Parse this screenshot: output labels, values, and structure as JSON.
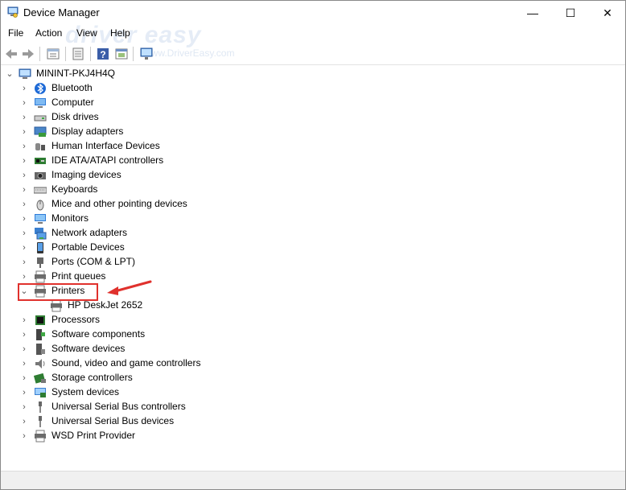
{
  "window": {
    "title": "Device Manager",
    "minimize": "—",
    "maximize": "☐",
    "close": "✕"
  },
  "menu": [
    "File",
    "Action",
    "View",
    "Help"
  ],
  "watermark": {
    "main": "driver easy",
    "sub": "www.DriverEasy.com"
  },
  "toolbar": [
    "back-icon",
    "forward-icon",
    "properties-icon",
    "update-icon",
    "help-icon",
    "device-view-icon",
    "scan-hardware-icon"
  ],
  "tree": {
    "root": "MININT-PKJ4H4Q",
    "categories": [
      {
        "label": "Bluetooth",
        "icon": "bluetooth-icon",
        "expanded": false
      },
      {
        "label": "Computer",
        "icon": "computer-icon",
        "expanded": false
      },
      {
        "label": "Disk drives",
        "icon": "disk-drive-icon",
        "expanded": false
      },
      {
        "label": "Display adapters",
        "icon": "display-adapter-icon",
        "expanded": false
      },
      {
        "label": "Human Interface Devices",
        "icon": "hid-icon",
        "expanded": false
      },
      {
        "label": "IDE ATA/ATAPI controllers",
        "icon": "ide-controller-icon",
        "expanded": false
      },
      {
        "label": "Imaging devices",
        "icon": "camera-icon",
        "expanded": false
      },
      {
        "label": "Keyboards",
        "icon": "keyboard-icon",
        "expanded": false
      },
      {
        "label": "Mice and other pointing devices",
        "icon": "mouse-icon",
        "expanded": false
      },
      {
        "label": "Monitors",
        "icon": "monitor-icon",
        "expanded": false
      },
      {
        "label": "Network adapters",
        "icon": "network-adapter-icon",
        "expanded": false
      },
      {
        "label": "Portable Devices",
        "icon": "portable-device-icon",
        "expanded": false
      },
      {
        "label": "Ports (COM & LPT)",
        "icon": "port-icon",
        "expanded": false
      },
      {
        "label": "Print queues",
        "icon": "print-queue-icon",
        "expanded": false
      },
      {
        "label": "Printers",
        "icon": "printer-icon",
        "expanded": true,
        "children": [
          "HP DeskJet 2652"
        ]
      },
      {
        "label": "Processors",
        "icon": "processor-icon",
        "expanded": false
      },
      {
        "label": "Software components",
        "icon": "software-component-icon",
        "expanded": false
      },
      {
        "label": "Software devices",
        "icon": "software-device-icon",
        "expanded": false
      },
      {
        "label": "Sound, video and game controllers",
        "icon": "speaker-icon",
        "expanded": false
      },
      {
        "label": "Storage controllers",
        "icon": "storage-controller-icon",
        "expanded": false
      },
      {
        "label": "System devices",
        "icon": "system-device-icon",
        "expanded": false
      },
      {
        "label": "Universal Serial Bus controllers",
        "icon": "usb-icon",
        "expanded": false
      },
      {
        "label": "Universal Serial Bus devices",
        "icon": "usb-icon",
        "expanded": false
      },
      {
        "label": "WSD Print Provider",
        "icon": "printer-icon",
        "expanded": false
      }
    ]
  },
  "annotation": {
    "highlight_color": "#e0312d",
    "target": "Printers"
  }
}
